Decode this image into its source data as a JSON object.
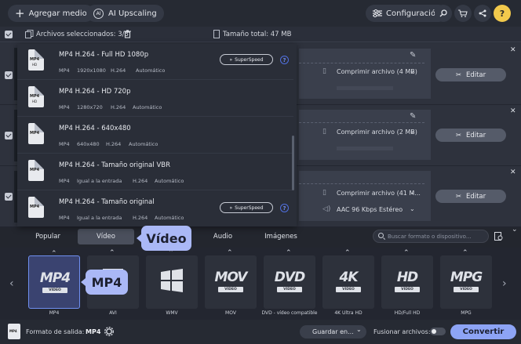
{
  "toolbar": {
    "add_media": "Agregar medio",
    "ai_upscaling": "AI Upscaling",
    "settings": "Configuración"
  },
  "filesbar": {
    "selected": "Archivos seleccionados: 3/3",
    "total_size": "Tamaño total: 47 MB"
  },
  "file_rows": [
    {
      "compress": "Comprimir archivo (4 MB)",
      "edit": "Editar"
    },
    {
      "compress": "Comprimir archivo (2 MB)",
      "edit": "Editar"
    },
    {
      "compress": "Comprimir archivo (41 M...",
      "audio": "AAC 96 Kbps Estéreo",
      "edit": "Editar"
    }
  ],
  "presets": [
    {
      "title": "MP4 H.264 - Full HD 1080p",
      "specs": [
        "MP4",
        "1920x1080",
        "H.264",
        "Automático"
      ],
      "superspeed": "SuperSpeed"
    },
    {
      "title": "MP4 H.264 - HD 720p",
      "specs": [
        "MP4",
        "1280x720",
        "H.264",
        "Automático"
      ]
    },
    {
      "title": "MP4 H.264 - 640x480",
      "specs": [
        "MP4",
        "640x480",
        "H.264",
        "Automático"
      ]
    },
    {
      "title": "MP4 H.264 - Tamaño original VBR",
      "specs": [
        "MP4",
        "Igual a la entrada",
        "H.264",
        "Automático"
      ]
    },
    {
      "title": "MP4 H.264 - Tamaño original",
      "specs": [
        "MP4",
        "Igual a la entrada",
        "H.264",
        "Automático"
      ],
      "superspeed": "SuperSpeed"
    }
  ],
  "tabs": [
    "Popular",
    "Vídeo",
    "Audio",
    "Imágenes"
  ],
  "search_placeholder": "Buscar formato o dispositivo...",
  "callout_video": "Vídeo",
  "callout_mp4": "MP4",
  "formats": [
    {
      "logo": "MP4",
      "sub": "VIDEO",
      "label": "MP4"
    },
    {
      "logo": "",
      "sub": "",
      "label": "AVI"
    },
    {
      "logo": "",
      "sub": "",
      "label": "WMV"
    },
    {
      "logo": "MOV",
      "sub": "VIDEO",
      "label": "MOV"
    },
    {
      "logo": "DVD",
      "sub": "VIDEO",
      "label": "DVD - vídeo compatible"
    },
    {
      "logo": "4K",
      "sub": "VIDEO",
      "label": "4K Ultra HD"
    },
    {
      "logo": "HD",
      "sub": "VIDEO",
      "label": "HD/Full HD"
    },
    {
      "logo": "MPG",
      "sub": "VIDEO",
      "label": "MPG"
    }
  ],
  "bottombar": {
    "output_format_label": "Formato de salida:",
    "output_format_value": "MP4",
    "save_to": "Guardar en...",
    "merge_files": "Fusionar archivos:",
    "convert": "Convertir"
  }
}
